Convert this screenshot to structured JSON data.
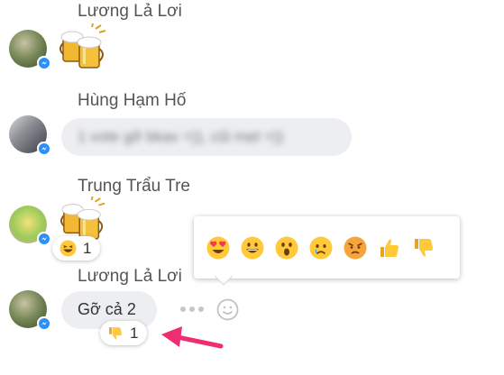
{
  "messages": [
    {
      "sender": "Lương Lả Lơi",
      "content": "beer-mugs-sticker"
    },
    {
      "sender": "Hùng Hạm Hố",
      "content": "1 vote gỡ bkav =)), cũi mẹt =))"
    },
    {
      "sender": "Trung Trẩu Tre",
      "content": "beer-mugs-sticker",
      "reaction": {
        "emoji": "laughing-emoji",
        "count": "1"
      }
    },
    {
      "sender": "Lương Lả Lơi",
      "content": "Gỡ cả 2",
      "reaction": {
        "emoji": "thumbs-down-emoji",
        "count": "1"
      }
    }
  ],
  "reaction_picker": [
    "love-eyes",
    "laugh",
    "wow",
    "sad",
    "angry",
    "thumbs-up",
    "thumbs-down"
  ],
  "colors": {
    "messenger_blue": "#2c8ef8",
    "bubble_gray": "#eceef1",
    "arrow_pink": "#ee2d72",
    "emoji_yellow": "#ffc93a"
  }
}
